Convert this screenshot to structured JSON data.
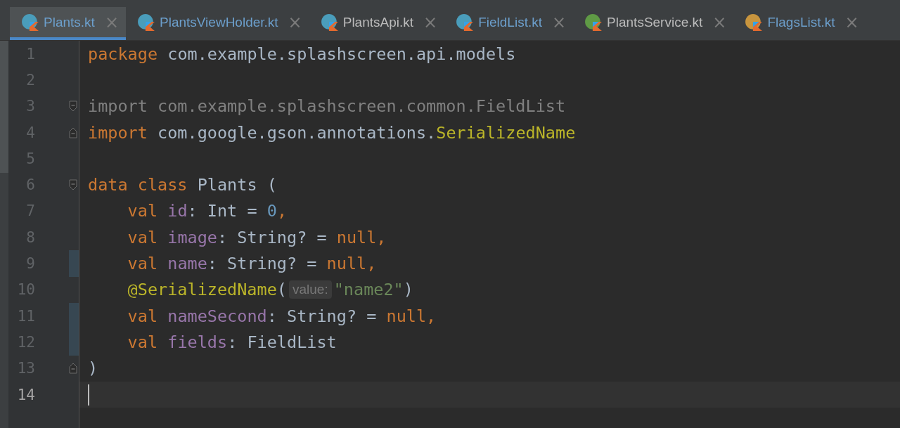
{
  "tabs": [
    {
      "label": "Plants.kt",
      "selected": true,
      "modified": true,
      "color": "#4a9dbb"
    },
    {
      "label": "PlantsViewHolder.kt",
      "selected": false,
      "modified": true,
      "color": "#4a9dbb"
    },
    {
      "label": "PlantsApi.kt",
      "selected": false,
      "modified": false,
      "color": "#4a9dbb"
    },
    {
      "label": "FieldList.kt",
      "selected": false,
      "modified": true,
      "color": "#4a9dbb"
    },
    {
      "label": "PlantsService.kt",
      "selected": false,
      "modified": false,
      "color": "#5f9a45"
    },
    {
      "label": "FlagsList.kt",
      "selected": false,
      "modified": true,
      "color": "#c8953e"
    }
  ],
  "close_glyph": "×",
  "lines": [
    {
      "number": "1",
      "fold_start": false,
      "fold_end": false,
      "changed": false,
      "current": false,
      "tokens": [
        {
          "kind": "keyword",
          "text": "package"
        },
        {
          "kind": "plain",
          "text": "com.example.splashscreen.api.models"
        }
      ]
    },
    {
      "number": "2",
      "fold_start": false,
      "fold_end": false,
      "changed": false,
      "current": false
    },
    {
      "number": "3",
      "fold_start": true,
      "fold_end": false,
      "changed": false,
      "current": false,
      "tokens": [
        {
          "kind": "dim",
          "text": "import com.example.splashscreen.common.FieldList"
        }
      ]
    },
    {
      "number": "4",
      "fold_start": false,
      "fold_end": true,
      "changed": false,
      "current": false,
      "tokens": [
        {
          "kind": "keyword",
          "text": "import"
        },
        {
          "kind": "plain",
          "text": "com.google.gson.annotations."
        },
        {
          "kind": "annotation",
          "text": "SerializedName"
        }
      ]
    },
    {
      "number": "5",
      "fold_start": false,
      "fold_end": false,
      "changed": false,
      "current": false
    },
    {
      "number": "6",
      "fold_start": true,
      "fold_end": false,
      "changed": false,
      "current": false,
      "tokens": [
        {
          "kind": "keyword",
          "text": "data class"
        },
        {
          "kind": "plain",
          "text": "Plants ("
        }
      ]
    },
    {
      "number": "7",
      "fold_start": false,
      "fold_end": false,
      "changed": false,
      "current": false,
      "tokens": [
        {
          "kind": "keyword",
          "text": "    val"
        },
        {
          "kind": "property",
          "text": "id"
        },
        {
          "kind": "plain",
          "text": ": Int = "
        },
        {
          "kind": "number",
          "text": "0"
        },
        {
          "kind": "keyword",
          "text": ","
        }
      ]
    },
    {
      "number": "8",
      "fold_start": false,
      "fold_end": false,
      "changed": false,
      "current": false,
      "tokens": [
        {
          "kind": "keyword",
          "text": "    val"
        },
        {
          "kind": "property",
          "text": "image"
        },
        {
          "kind": "plain",
          "text": ": String? = "
        },
        {
          "kind": "keyword",
          "text": "null,"
        }
      ]
    },
    {
      "number": "9",
      "fold_start": false,
      "fold_end": false,
      "changed": true,
      "current": false,
      "tokens": [
        {
          "kind": "keyword",
          "text": "    val"
        },
        {
          "kind": "property",
          "text": "name"
        },
        {
          "kind": "plain",
          "text": ": String? = "
        },
        {
          "kind": "keyword",
          "text": "null,"
        }
      ]
    },
    {
      "number": "10",
      "fold_start": false,
      "fold_end": false,
      "changed": false,
      "current": false,
      "tokens": [
        {
          "kind": "annotation",
          "text": "    @SerializedName"
        },
        {
          "kind": "plain",
          "text": "("
        },
        {
          "kind": "hint",
          "text": "value:"
        },
        {
          "kind": "string",
          "text": "\"name2\""
        },
        {
          "kind": "plain",
          "text": ")"
        }
      ]
    },
    {
      "number": "11",
      "fold_start": false,
      "fold_end": false,
      "changed": true,
      "current": false,
      "tokens": [
        {
          "kind": "keyword",
          "text": "    val"
        },
        {
          "kind": "property",
          "text": "nameSecond"
        },
        {
          "kind": "plain",
          "text": ": String? = "
        },
        {
          "kind": "keyword",
          "text": "null,"
        }
      ]
    },
    {
      "number": "12",
      "fold_start": false,
      "fold_end": false,
      "changed": true,
      "current": false,
      "tokens": [
        {
          "kind": "keyword",
          "text": "    val"
        },
        {
          "kind": "property",
          "text": "fields"
        },
        {
          "kind": "plain",
          "text": ": FieldList"
        }
      ]
    },
    {
      "number": "13",
      "fold_start": false,
      "fold_end": true,
      "changed": false,
      "current": false,
      "tokens": [
        {
          "kind": "plain",
          "text": ")"
        }
      ]
    },
    {
      "number": "14",
      "fold_start": false,
      "fold_end": false,
      "changed": false,
      "current": true
    }
  ]
}
